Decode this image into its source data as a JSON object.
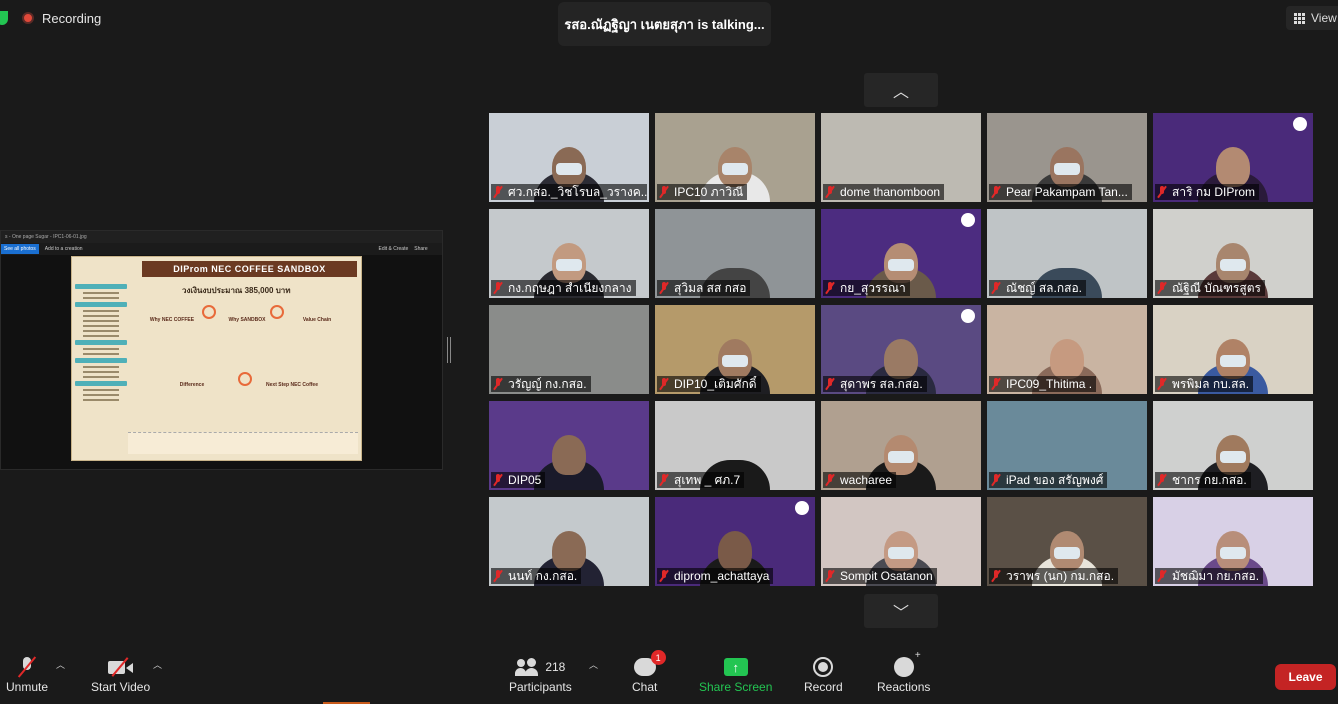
{
  "top": {
    "recording_label": "Recording",
    "talking_banner": "รสอ.ณัฏฐิญา เนตยสุภา is  talking...",
    "view_label": "View"
  },
  "share": {
    "toolbar_title": "s - One page Sugar - IPC1-06-01.jpg",
    "see_all": "See all photos",
    "add_to": "Add to a creation",
    "edit_create": "Edit & Create",
    "share": "Share",
    "poster_title": "DIProm NEC COFFEE SANDBOX",
    "poster_budget": "วงเงินงบประมาณ 385,000 บาท",
    "col1": "Why NEC COFFEE",
    "col2": "Why SANDBOX",
    "col3": "Value Chain",
    "col4": "Difference",
    "col5": "Next Step NEC Coffee"
  },
  "participants": [
    {
      "name": "ศว.กสอ._วิชโรบล_วรางค...",
      "bg": "#c9cfd6",
      "face": "#8a6a55",
      "masked": true,
      "body": "#2c2c35"
    },
    {
      "name": "IPC10 ภาวิณี",
      "bg": "#a9a190",
      "face": "#a8846a",
      "masked": true,
      "body": "#e8e8e8"
    },
    {
      "name": "dome thanomboon",
      "bg": "#bdbab2",
      "face": null,
      "masked": false,
      "body": null
    },
    {
      "name": "Pear Pakampam Tan...",
      "bg": "#9a958e",
      "face": "#9a7560",
      "masked": true,
      "body": "#3a3a3a"
    },
    {
      "name": "สาริ กม DIProm",
      "bg": "#4a2a7a",
      "face": "#b38a72",
      "masked": false,
      "body": "#2a1a3a",
      "logo": true
    },
    {
      "name": "กง.กฤษฎา สำเนียงกลาง",
      "bg": "#c5c9cc",
      "face": "#c29a80",
      "masked": true,
      "body": "#2a2a30"
    },
    {
      "name": "สุวิมล สส กสอ",
      "bg": "#8f9497",
      "face": null,
      "masked": false,
      "body": "#444"
    },
    {
      "name": "กย_สุวรรณา",
      "bg": "#4c2c80",
      "face": "#b58d74",
      "masked": true,
      "body": "#6a5a4a",
      "logo": true
    },
    {
      "name": "ณัชญ์ สล.กสอ.",
      "bg": "#bfc4c6",
      "face": null,
      "masked": false,
      "body": "#3a4a5a"
    },
    {
      "name": "ณัฐิณี บัณฑรสูตร",
      "bg": "#d0d0cc",
      "face": "#a8866e",
      "masked": true,
      "body": "#5a3a3a"
    },
    {
      "name": "วรัญญ์ กง.กสอ.",
      "bg": "#8a8c8a",
      "face": null,
      "masked": false,
      "body": null
    },
    {
      "name": "DIP10_เติมศักดิ์",
      "bg": "#b59a6a",
      "face": "#a07a60",
      "masked": true,
      "body": "#1e1e22"
    },
    {
      "name": "สุดาพร สล.กสอ.",
      "bg": "#5a4a82",
      "face": "#9a7a64",
      "masked": false,
      "body": "#2a2a40",
      "logo": true
    },
    {
      "name": "IPC09_Thitima .",
      "bg": "#c9b4a2",
      "face": "#c69a80",
      "masked": false,
      "body": "#8a6a5a"
    },
    {
      "name": "พรพิมล กบ.สล.",
      "bg": "#d9d2c4",
      "face": "#b08266",
      "masked": true,
      "body": "#3a5aa0"
    },
    {
      "name": "DIP05",
      "bg": "#5a3a8a",
      "face": "#8a6a55",
      "masked": false,
      "body": "#1a1a2a"
    },
    {
      "name": "สุเทพ _ ศภ.7",
      "bg": "#c9c9c9",
      "face": null,
      "masked": false,
      "body": "#1a1a1a"
    },
    {
      "name": "wacharee",
      "bg": "#b0a090",
      "face": "#b48a70",
      "masked": true,
      "body": "#1a1a1a"
    },
    {
      "name": "iPad ของ สรัญพงศ์",
      "bg": "#6a8a9a",
      "face": null,
      "masked": false,
      "body": null
    },
    {
      "name": "ชากร กย.กสอ.",
      "bg": "#cfd0cf",
      "face": "#a07a5e",
      "masked": true,
      "body": "#1e1e22"
    },
    {
      "name": "นนท์ กง.กสอ.",
      "bg": "#c4c9cc",
      "face": "#8a6a55",
      "masked": false,
      "body": "#223"
    },
    {
      "name": "diprom_achattaya",
      "bg": "#4a2a7a",
      "face": "#7a5a48",
      "masked": false,
      "body": "#1a1a1a",
      "logo": true
    },
    {
      "name": "Sompit Osatanon",
      "bg": "#d2c6c2",
      "face": "#c49a84",
      "masked": true,
      "body": "#4a4a52"
    },
    {
      "name": "วราพร (นก) กม.กสอ.",
      "bg": "#5a5046",
      "face": "#b08a72",
      "masked": true,
      "body": "#e8e4da"
    },
    {
      "name": "มัชฌิมา กย.กสอ.",
      "bg": "#d8d0e6",
      "face": "#b88e7a",
      "masked": true,
      "body": "#6a4a8a"
    }
  ],
  "bottom": {
    "unmute": "Unmute",
    "start_video": "Start Video",
    "participants_count": "218",
    "participants": "Participants",
    "chat": "Chat",
    "chat_badge": "1",
    "share_screen": "Share Screen",
    "record": "Record",
    "reactions": "Reactions",
    "leave": "Leave"
  },
  "colors": {
    "accent_green": "#23c552",
    "leave_red": "#c42424",
    "mute_red": "#e02828"
  }
}
